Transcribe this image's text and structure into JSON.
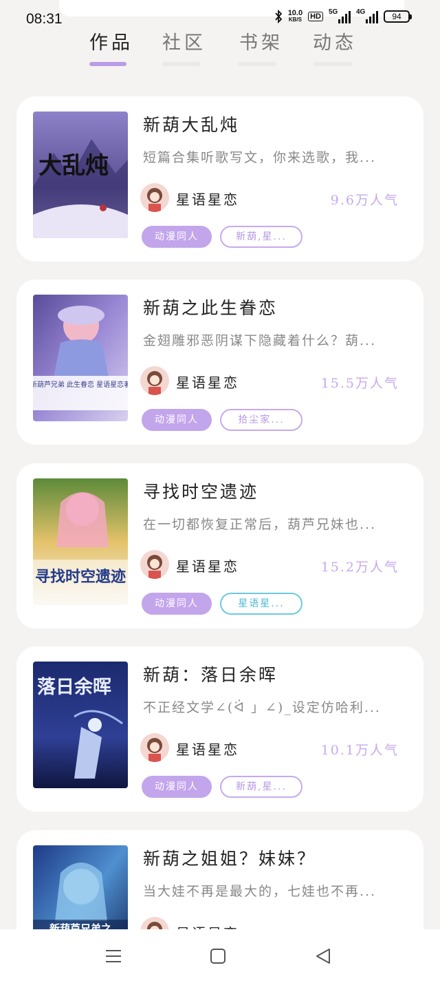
{
  "status_bar": {
    "time": "08:31",
    "net_speed": "10.0",
    "net_unit": "KB/S",
    "hd_label": "HD",
    "sig1_label": "5G",
    "sig2_label": "4G",
    "battery": "94",
    "icons": [
      "bluetooth-icon",
      "hd-icon",
      "signal-5g-icon",
      "signal-4g-icon",
      "battery-icon"
    ]
  },
  "tabs": [
    {
      "label": "作品",
      "active": true
    },
    {
      "label": "社区",
      "active": false
    },
    {
      "label": "书架",
      "active": false
    },
    {
      "label": "动态",
      "active": false
    }
  ],
  "books": [
    {
      "title": "新葫大乱炖",
      "desc": "短篇合集听歌写文，你来选歌，我...",
      "author": "星语星恋",
      "popularity": "9.6万人气",
      "tag1": "动漫同人",
      "tag2": "新葫,星...",
      "tag2_style": "purple",
      "cover_text": "大乱炖"
    },
    {
      "title": "新葫之此生眷恋",
      "desc": "金翅雕邪恶阴谋下隐藏着什么？葫...",
      "author": "星语星恋",
      "popularity": "15.5万人气",
      "tag1": "动漫同人",
      "tag2": "拾尘家...",
      "tag2_style": "purple",
      "cover_text": "新葫芦兄弟 此生眷恋 星语星恋著"
    },
    {
      "title": "寻找时空遗迹",
      "desc": "在一切都恢复正常后，葫芦兄妹也...",
      "author": "星语星恋",
      "popularity": "15.2万人气",
      "tag1": "动漫同人",
      "tag2": "星语星...",
      "tag2_style": "teal",
      "cover_text": "寻找时空遗迹"
    },
    {
      "title": "新葫：落日余晖",
      "desc": "不正经文学∠(ᐛ 」∠)_设定仿哈利...",
      "author": "星语星恋",
      "popularity": "10.1万人气",
      "tag1": "动漫同人",
      "tag2": "新葫,星...",
      "tag2_style": "purple",
      "cover_text": "落日余晖"
    },
    {
      "title": "新葫之姐姐？妹妹？",
      "desc": "当大娃不再是最大的，七娃也不再...",
      "author": "星语星恋",
      "popularity": "",
      "tag1": "",
      "tag2": "",
      "tag2_style": "purple",
      "cover_text": "新葫芦兄弟之"
    }
  ],
  "nav": {
    "menu_icon": "menu-icon",
    "home_icon": "home-square-icon",
    "back_icon": "back-triangle-icon"
  },
  "colors": {
    "accent": "#b99be6",
    "popularity": "#c6a9ee",
    "tag_fill": "#c3a5ec",
    "tag_teal": "#6dc8dd",
    "background": "#f4f3f1"
  }
}
